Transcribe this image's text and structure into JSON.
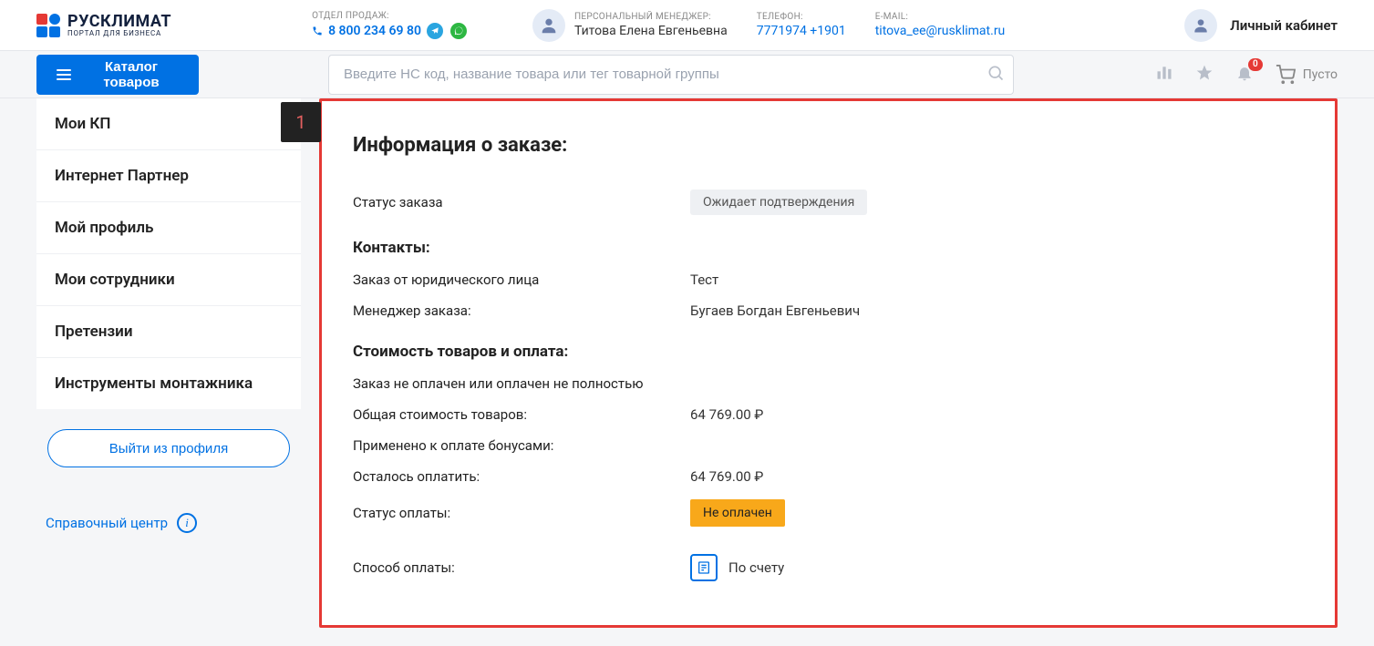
{
  "header": {
    "logo_title": "РУСКЛИМАТ",
    "logo_sub": "ПОРТАЛ ДЛЯ БИЗНЕСА",
    "sales_dept_label": "ОТДЕЛ ПРОДАЖ:",
    "sales_phone": "8 800 234 69 80",
    "manager_label": "ПЕРСОНАЛЬНЫЙ МЕНЕДЖЕР:",
    "manager_name": "Титова Елена Евгеньевна",
    "phone_label": "ТЕЛЕФОН:",
    "phone_value": "7771974 +1901",
    "email_label": "E-MAIL:",
    "email_value": "titova_ee@rusklimat.ru",
    "account_link": "Личный кабинет",
    "catalog_button": "Каталог товаров",
    "search_placeholder": "Введите НС код, название товара или тег товарной группы",
    "notif_count": "0",
    "cart_label": "Пусто"
  },
  "step_marker": "1",
  "sidebar": {
    "items": [
      {
        "label": "Мои КП"
      },
      {
        "label": "Интернет Партнер"
      },
      {
        "label": "Мой профиль"
      },
      {
        "label": "Мои сотрудники"
      },
      {
        "label": "Претензии"
      },
      {
        "label": "Инструменты монтажника"
      }
    ],
    "logout_label": "Выйти из профиля",
    "help_label": "Справочный центр"
  },
  "order": {
    "title": "Информация о заказе:",
    "status_label": "Статус заказа",
    "status_value": "Ожидает подтверждения",
    "contacts_header": "Контакты:",
    "legal_label": "Заказ от юридического лица",
    "legal_value": "Тест",
    "manager_label": "Менеджер заказа:",
    "manager_value": "Бугаев Богдан Евгеньевич",
    "cost_header": "Стоимость товаров и оплата:",
    "paid_note": "Заказ не оплачен или оплачен не полностью",
    "total_label": "Общая стоимость товаров:",
    "total_value": "64 769.00 ₽",
    "bonus_label": "Применено к оплате бонусами:",
    "bonus_value": "",
    "remain_label": "Осталось оплатить:",
    "remain_value": "64 769.00 ₽",
    "pay_status_label": "Статус оплаты:",
    "pay_status_value": "Не оплачен",
    "pay_method_label": "Способ оплаты:",
    "pay_method_value": "По счету"
  }
}
